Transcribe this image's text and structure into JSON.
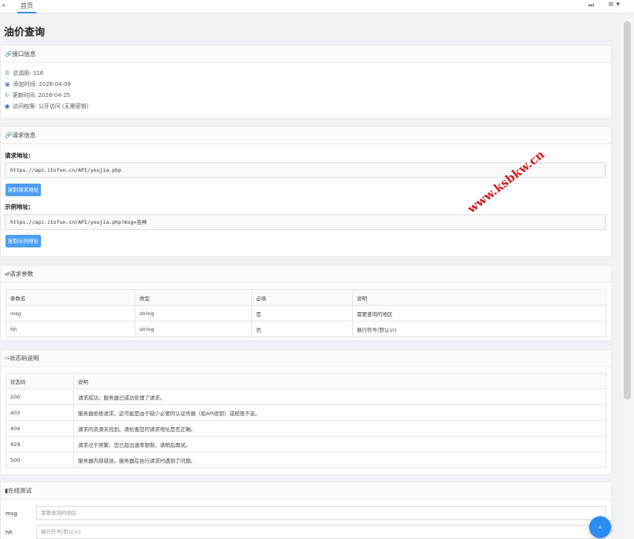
{
  "topbar": {
    "left_arrow": "«",
    "tab_label": "首页",
    "right_arrow": "⏭",
    "menu": "≡ ▾"
  },
  "page_title": "油价查询",
  "api_info": {
    "heading": "🔗接口信息",
    "lines": [
      {
        "icon": "list-icon",
        "glyph": "☰",
        "text": "总调用: 116"
      },
      {
        "icon": "calendar-icon",
        "glyph": "▣",
        "text": "添加时间: 2026-04-09"
      },
      {
        "icon": "refresh-icon",
        "glyph": "↻",
        "text": "更新时间: 2026-04-25"
      },
      {
        "icon": "user-icon",
        "glyph": "●",
        "text": "访问权限: 公开访问 (无需密钥)"
      }
    ]
  },
  "request_info": {
    "heading": "🔗请求信息",
    "url_label": "请求地址:",
    "url": "https://api.itofun.cn/API/youjia.php",
    "copy_url_button": "复制请求地址",
    "example_label": "示例地址:",
    "example_url": "https://api.itofun.cn/API/youjia.php?msg=吉林",
    "copy_example_button": "复制示例地址"
  },
  "params": {
    "heading": "⇌请求参数",
    "headers": [
      "参数名",
      "类型",
      "必填",
      "说明"
    ],
    "rows": [
      [
        "msg",
        "string",
        "是",
        "需要查询的地区"
      ],
      [
        "hh",
        "string",
        "否",
        "换行符号(默认\\n)"
      ]
    ]
  },
  "status_codes": {
    "heading": "‹›状态码说明",
    "headers": [
      "状态码",
      "说明"
    ],
    "rows": [
      [
        "200",
        "请求成功，服务器已成功处理了请求。"
      ],
      [
        "403",
        "服务器拒绝请求。这可能是由于缺少必要的认证凭据（如API密钥）或权限不足。"
      ],
      [
        "404",
        "请求的资源未找到。请检查您的请求地址是否正确。"
      ],
      [
        "429",
        "请求过于频繁。您已超出速率限制，请稍后再试。"
      ],
      [
        "500",
        "服务器内部错误。服务器在执行请求时遇到了问题。"
      ]
    ]
  },
  "online_test": {
    "heading": "▮在线测试",
    "fields": [
      {
        "label": "msg",
        "placeholder": "需要查询的地区"
      },
      {
        "label": "hh",
        "placeholder": "换行符号(默认\\n)"
      }
    ]
  },
  "fab_label": "«",
  "watermark": "www.ksbkw.cn"
}
